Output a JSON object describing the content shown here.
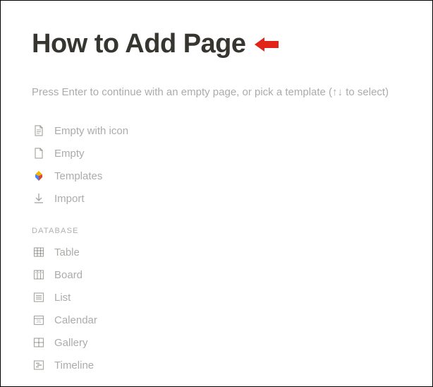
{
  "title": "How to Add Page",
  "hint": "Press Enter to continue with an empty page, or pick a template (↑↓ to select)",
  "options": [
    {
      "label": "Empty with icon"
    },
    {
      "label": "Empty"
    },
    {
      "label": "Templates"
    },
    {
      "label": "Import"
    }
  ],
  "database_section": {
    "label": "DATABASE",
    "items": [
      {
        "label": "Table"
      },
      {
        "label": "Board"
      },
      {
        "label": "List"
      },
      {
        "label": "Calendar"
      },
      {
        "label": "Gallery"
      },
      {
        "label": "Timeline"
      }
    ]
  }
}
